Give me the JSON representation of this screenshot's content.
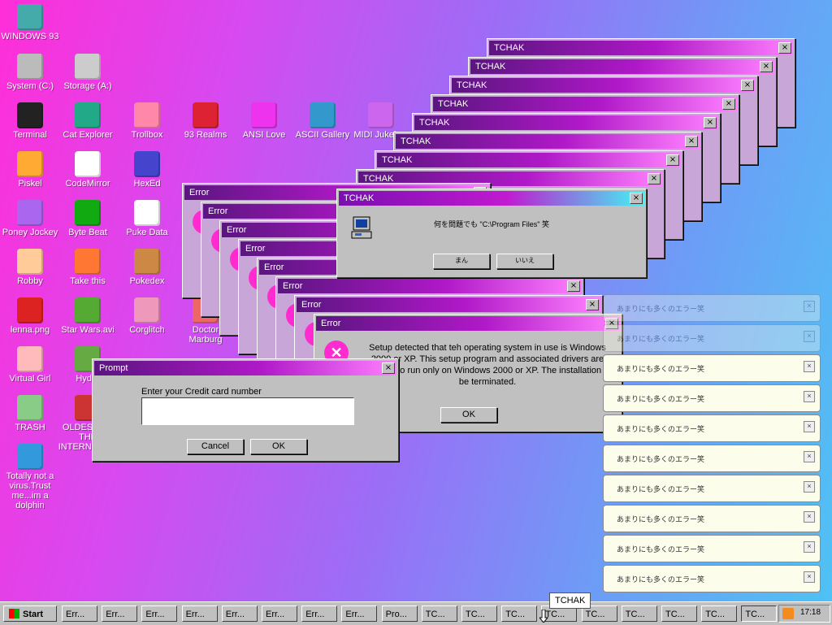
{
  "desktop_icons": [
    {
      "label": "WINDOWS 93",
      "icon": "computer-icon"
    },
    {
      "label": "System (C:)",
      "icon": "drive-icon"
    },
    {
      "label": "Storage (A:)",
      "icon": "floppy-drive-icon"
    },
    {
      "label": "Terminal",
      "icon": "terminal-icon"
    },
    {
      "label": "Cat Explorer",
      "icon": "globe-cat-icon"
    },
    {
      "label": "Trollbox",
      "icon": "chat-bubble-icon"
    },
    {
      "label": "93 Realms",
      "icon": "knight-icon"
    },
    {
      "label": "ANSI Love",
      "icon": "letter-a-icon"
    },
    {
      "label": "ASCII Gallery",
      "icon": "numbers-icon"
    },
    {
      "label": "MIDI Jukebox",
      "icon": "piano-icon"
    },
    {
      "label": "Piskel",
      "icon": "palette-icon"
    },
    {
      "label": "CodeMirror",
      "icon": "code-cat-icon"
    },
    {
      "label": "HexEd",
      "icon": "cube-icon"
    },
    {
      "label": "Poney Jockey",
      "icon": "pony-icon"
    },
    {
      "label": "Byte Beat",
      "icon": "wave-icon"
    },
    {
      "label": "Puke Data",
      "icon": "pd-icon"
    },
    {
      "label": "Robby",
      "icon": "robot-icon"
    },
    {
      "label": "Take this",
      "icon": "pixel-man-icon"
    },
    {
      "label": "Pokedex",
      "icon": "pokeball-icon"
    },
    {
      "label": "lenna.png",
      "icon": "image-file-icon"
    },
    {
      "label": "Star Wars.avi",
      "icon": "yoda-icon"
    },
    {
      "label": "Corglitch",
      "icon": "dog-icon"
    },
    {
      "label": "Virtual Girl",
      "icon": "girl-icon"
    },
    {
      "label": "Hydra",
      "icon": "hydra-icon"
    },
    {
      "label": "Doctor Marburg",
      "icon": "doctor-icon"
    },
    {
      "label": "TRASH",
      "icon": "trash-icon"
    },
    {
      "label": "OLDEST OF THE INTERNET girl",
      "icon": "video-file-icon"
    },
    {
      "label": "Totally not a virus.Trust me...im a dolphin",
      "icon": "dolphin-icon"
    }
  ],
  "error_dialog": {
    "title": "Error",
    "message": "Setup detected that teh operating system in use is Windows 2000 or XP. This setup program and associated drivers are designed to run only on Windows 2000 or XP. The installation will be terminated.",
    "ok": "OK"
  },
  "tchak_dialog": {
    "title": "TCHAK",
    "message": "何を問題でも \"C:\\Program Files\" 笑",
    "yes": "まん",
    "no": "いいえ"
  },
  "prompt_dialog": {
    "title": "Prompt",
    "label": "Enter your Credit card number",
    "value": "",
    "cancel": "Cancel",
    "ok": "OK"
  },
  "stack_title_tchak": "TCHAK",
  "stack_title_error": "Error",
  "notification_text": "あまりにも多くのエラー笑",
  "notification_close": "×",
  "window_close": "×",
  "taskbar": {
    "start": "Start",
    "buttons": [
      "Err...",
      "Err...",
      "Err...",
      "Err...",
      "Err...",
      "Err...",
      "Err...",
      "Err...",
      "Pro...",
      "TC...",
      "TC...",
      "TC...",
      "TC...",
      "TC...",
      "TC...",
      "TC...",
      "TC...",
      "TC..."
    ],
    "tooltip": "TCHAK",
    "clock": "17:18"
  },
  "colors": {
    "accent": "#b018c8",
    "title_start": "#5b1580",
    "chrome": "#c0c0c0"
  }
}
